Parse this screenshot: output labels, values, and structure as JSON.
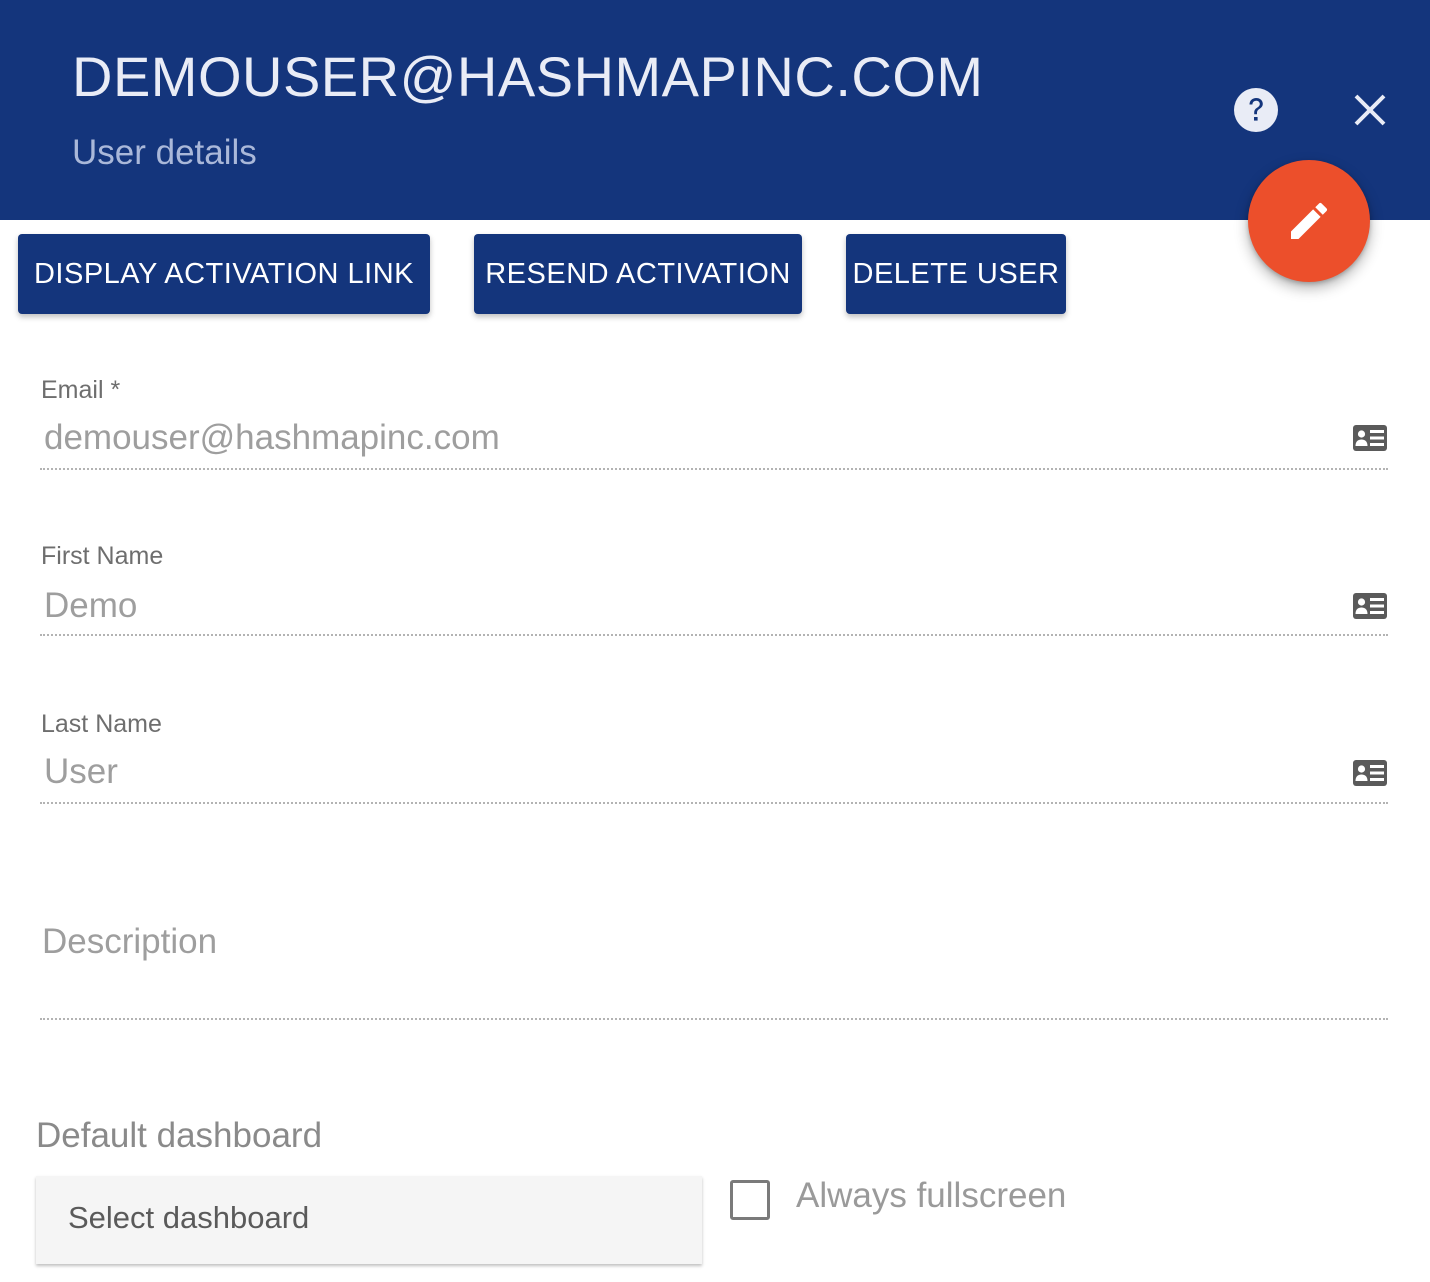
{
  "header": {
    "title": "DEMOUSER@HASHMAPINC.COM",
    "subtitle": "User details",
    "background_color": "#14357c",
    "help_icon": "help-circle-icon",
    "close_icon": "close-icon"
  },
  "fab": {
    "icon": "pencil-icon",
    "color": "#ec4f2b"
  },
  "actions": {
    "display_activation_link": "DISPLAY ACTIVATION LINK",
    "resend_activation": "RESEND ACTIVATION",
    "delete_user": "DELETE USER"
  },
  "form": {
    "email": {
      "label": "Email *",
      "value": "demouser@hashmapinc.com",
      "icon": "contact-card-icon"
    },
    "first_name": {
      "label": "First Name",
      "value": "Demo",
      "icon": "contact-card-icon"
    },
    "last_name": {
      "label": "Last Name",
      "value": "User",
      "icon": "contact-card-icon"
    },
    "description": {
      "placeholder": "Description",
      "value": ""
    },
    "default_dashboard": {
      "label": "Default dashboard",
      "placeholder": "Select dashboard"
    },
    "always_fullscreen": {
      "label": "Always fullscreen",
      "checked": false
    }
  }
}
